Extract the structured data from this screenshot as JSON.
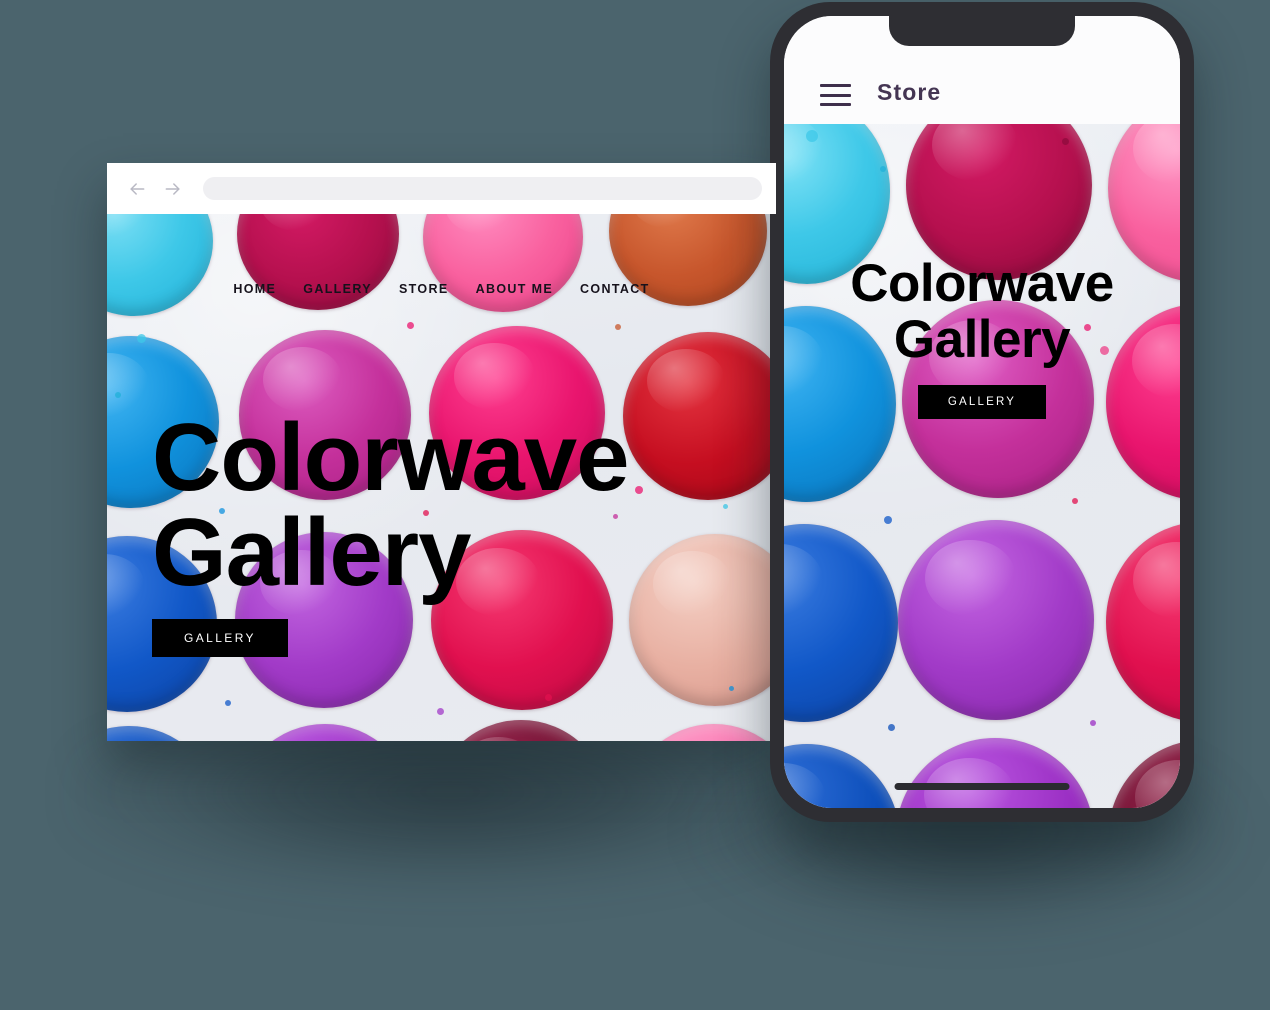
{
  "background": {
    "color": "#4b646d"
  },
  "browser": {
    "name": "Browser Window Mockup",
    "chrome": {
      "back_icon": "arrow-left-icon",
      "forward_icon": "arrow-right-icon",
      "url_value": "",
      "url_placeholder": ""
    },
    "site": {
      "nav": [
        {
          "label": "HOME"
        },
        {
          "label": "GALLERY"
        },
        {
          "label": "STORE"
        },
        {
          "label": "ABOUT ME"
        },
        {
          "label": "CONTACT"
        }
      ],
      "hero": {
        "title_line1": "Colorwave",
        "title_line2": "Gallery",
        "button_label": "GALLERY"
      }
    }
  },
  "phone": {
    "name": "Phone Mockup",
    "topbar": {
      "menu_icon": "hamburger-menu-icon",
      "title": "Store"
    },
    "hero": {
      "title_line1": "Colorwave",
      "title_line2": "Gallery",
      "button_label": "GALLERY"
    }
  },
  "palette_colors": {
    "cyan": "#3ec8e8",
    "crimson": "#b5104e",
    "pink": "#f9619f",
    "orange": "#c7562c",
    "blue": "#1092dd",
    "magenta": "#c4309b",
    "hot_pink": "#e9156e",
    "red": "#c50e20",
    "royal_blue": "#1158c8",
    "purple": "#a23bc8",
    "rose": "#e1104f",
    "peach": "#e8b0a2",
    "dark_blue": "#0d4fbb",
    "violet": "#9b2fc4",
    "maroon": "#6d1030",
    "light_pink": "#f86fae",
    "deep_pink": "#ef2f7e"
  }
}
